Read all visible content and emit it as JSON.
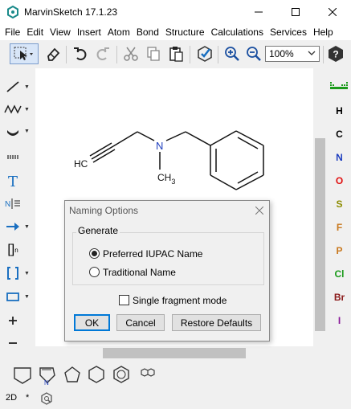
{
  "window": {
    "title": "MarvinSketch 17.1.23"
  },
  "menu": [
    "File",
    "Edit",
    "View",
    "Insert",
    "Atom",
    "Bond",
    "Structure",
    "Calculations",
    "Services",
    "Help"
  ],
  "toolbar": {
    "zoom_value": "100%"
  },
  "left_tools": {
    "text_tool": "T",
    "bracket_label": "[]",
    "bracket_sub": "n"
  },
  "periodic": [
    {
      "symbol": "H",
      "color": "#000000"
    },
    {
      "symbol": "C",
      "color": "#000000"
    },
    {
      "symbol": "N",
      "color": "#1f3fbf"
    },
    {
      "symbol": "O",
      "color": "#e01010"
    },
    {
      "symbol": "S",
      "color": "#8c8c00"
    },
    {
      "symbol": "F",
      "color": "#c8781e"
    },
    {
      "symbol": "P",
      "color": "#c8781e"
    },
    {
      "symbol": "Cl",
      "color": "#1a9a1a"
    },
    {
      "symbol": "Br",
      "color": "#8b1a1a"
    },
    {
      "symbol": "I",
      "color": "#8a1a9a"
    }
  ],
  "molecule": {
    "label_hc": "HC",
    "label_n": "N",
    "label_ch3": "CH",
    "label_ch3_sub": "3"
  },
  "dialog": {
    "title": "Naming Options",
    "group_label": "Generate",
    "option_preferred": "Preferred IUPAC Name",
    "option_traditional": "Traditional Name",
    "selected": "Preferred IUPAC Name",
    "single_fragment": "Single fragment mode",
    "single_fragment_checked": false,
    "ok": "OK",
    "cancel": "Cancel",
    "restore": "Restore Defaults"
  },
  "status": {
    "mode": "2D",
    "star": "*"
  }
}
